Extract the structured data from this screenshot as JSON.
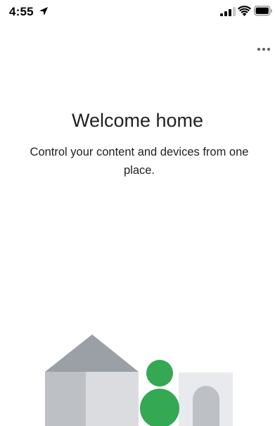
{
  "status_bar": {
    "time": "4:55",
    "icons": [
      "location-arrow-icon",
      "cellular-signal-icon",
      "wifi-icon",
      "battery-icon"
    ]
  },
  "menu": {
    "icon": "more-horizontal-icon"
  },
  "welcome": {
    "title": "Welcome home",
    "subtitle": "Control your content and devices from one place."
  },
  "colors": {
    "text": "#202124",
    "house_roof": "#9aa0a6",
    "house_wall": "#dadce0",
    "house_wall_dark": "#bdc1c6",
    "person_green": "#34a853",
    "background": "#ffffff"
  }
}
